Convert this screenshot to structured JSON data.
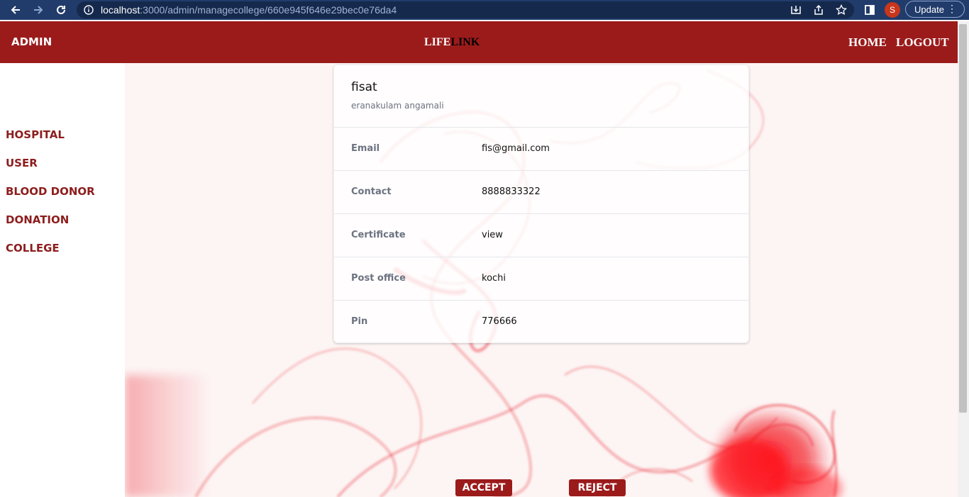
{
  "browser": {
    "url_host": "localhost",
    "url_path": ":3000/admin/managecollege/660e945f646e29bec0e76da4",
    "profile_initial": "S",
    "update_label": "Update"
  },
  "header": {
    "brand": "ADMIN",
    "logo_part1": "LIFE",
    "logo_part2": "LINK",
    "nav": [
      "HOME",
      "LOGOUT"
    ]
  },
  "sidebar": {
    "items": [
      "HOSPITAL",
      "USER",
      "BLOOD DONOR",
      "DONATION",
      "COLLEGE"
    ]
  },
  "card": {
    "title": "fisat",
    "subtitle": "eranakulam angamali",
    "rows": [
      {
        "label": "Email",
        "value": "fis@gmail.com"
      },
      {
        "label": "Contact",
        "value": "8888833322"
      },
      {
        "label": "Certificate",
        "value": "view"
      },
      {
        "label": "Post office",
        "value": "kochi"
      },
      {
        "label": "Pin",
        "value": "776666"
      }
    ]
  },
  "actions": {
    "accept": "ACCEPT",
    "reject": "REJECT"
  },
  "colors": {
    "header_bg": "#9b1b1b",
    "accent_text": "#8d1d1d",
    "chrome_bg": "#213c6b",
    "smoke_red": "#e8101a"
  }
}
